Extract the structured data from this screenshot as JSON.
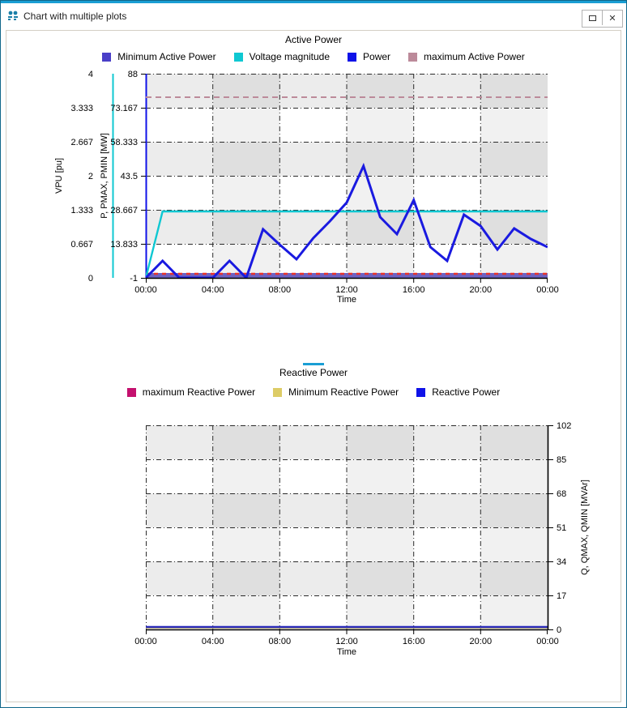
{
  "window": {
    "title": "Chart with multiple plots",
    "icon": "chart-window-icon",
    "restore_label": "❐",
    "close_label": "✕",
    "accent_color": "#1a9ed4"
  },
  "charts": [
    {
      "id": "active-power",
      "title": "Active Power",
      "selected": false,
      "legend": [
        {
          "label": "Minimum Active Power",
          "color": "#4a3fc8"
        },
        {
          "label": "Voltage magnitude",
          "color": "#0fc8d2"
        },
        {
          "label": "Power",
          "color": "#0f12e8"
        },
        {
          "label": "maximum Active Power",
          "color": "#bc8a9a"
        }
      ],
      "axes": {
        "left_outer": {
          "title": "VPU [pu]",
          "ticks": [
            "0",
            "0.667",
            "1.333",
            "2",
            "2.667",
            "3.333",
            "4"
          ],
          "min": 0,
          "max": 4,
          "color": "#0fc8d2"
        },
        "left_inner": {
          "title": "P, PMAX, PMIN [MW]",
          "ticks": [
            "-1",
            "13.833",
            "28.667",
            "43.5",
            "58.333",
            "73.167",
            "88"
          ],
          "min": -1,
          "max": 88,
          "color": "#0f12e8"
        },
        "x": {
          "title": "Time",
          "ticks": [
            "00:00",
            "04:00",
            "08:00",
            "12:00",
            "16:00",
            "20:00",
            "00:00"
          ]
        }
      }
    },
    {
      "id": "reactive-power",
      "title": "Reactive Power",
      "selected": true,
      "legend": [
        {
          "label": "maximum Reactive Power",
          "color": "#c4106e"
        },
        {
          "label": "Minimum Reactive Power",
          "color": "#ddcc66"
        },
        {
          "label": "Reactive Power",
          "color": "#0f12e8"
        }
      ],
      "axes": {
        "right": {
          "title": "Q, QMAX, QMIN [MVAr]",
          "ticks": [
            "0",
            "17",
            "34",
            "51",
            "68",
            "85",
            "102"
          ],
          "min": 0,
          "max": 102
        },
        "x": {
          "title": "Time",
          "ticks": [
            "00:00",
            "04:00",
            "08:00",
            "12:00",
            "16:00",
            "20:00",
            "00:00"
          ]
        }
      }
    }
  ],
  "chart_data": [
    {
      "type": "line",
      "title": "Active Power",
      "xlabel": "Time",
      "ylabel": "P, PMAX, PMIN [MW]",
      "y2label": "VPU [pu]",
      "xtick_labels": [
        "00:00",
        "04:00",
        "08:00",
        "12:00",
        "16:00",
        "20:00",
        "00:00"
      ],
      "xlim": [
        0,
        24
      ],
      "ylim": [
        -1,
        88
      ],
      "y2lim": [
        0,
        4
      ],
      "grid": true,
      "legend_position": "top",
      "x": [
        0,
        1,
        2,
        3,
        4,
        5,
        6,
        7,
        8,
        9,
        10,
        11,
        12,
        13,
        14,
        15,
        16,
        17,
        18,
        19,
        20,
        21,
        22,
        23,
        24
      ],
      "series": [
        {
          "name": "Power",
          "color": "#0f12e8",
          "axis": "left",
          "values": [
            -1,
            6.5,
            -1,
            -1,
            -1,
            6.5,
            -1,
            19.0,
            13.8,
            7.2,
            16.5,
            24.5,
            33.5,
            49.5,
            25.0,
            16.8,
            34.0,
            13.0,
            6.5,
            27.0,
            22.0,
            12.5,
            21.5,
            17.5,
            13.0
          ]
        },
        {
          "name": "Voltage magnitude",
          "color": "#0fc8d2",
          "axis": "right",
          "values": [
            0.0,
            0.97,
            0.97,
            0.97,
            0.97,
            0.97,
            0.97,
            0.97,
            0.97,
            0.97,
            0.97,
            0.97,
            0.97,
            0.97,
            0.97,
            0.97,
            0.97,
            0.97,
            0.97,
            0.97,
            0.97,
            0.97,
            0.97,
            0.97,
            0.97
          ]
        },
        {
          "name": "maximum Active Power",
          "color": "#bc8a9a",
          "axis": "left",
          "style": "dashed",
          "values": [
            80.5,
            80.5,
            80.5,
            80.5,
            80.5,
            80.5,
            80.5,
            80.5,
            80.5,
            80.5,
            80.5,
            80.5,
            80.5,
            80.5,
            80.5,
            80.5,
            80.5,
            80.5,
            80.5,
            80.5,
            80.5,
            80.5,
            80.5,
            80.5,
            80.5
          ]
        },
        {
          "name": "Minimum Active Power",
          "color": "#4a3fc8",
          "axis": "left",
          "values": [
            0,
            0,
            0,
            0,
            0,
            0,
            0,
            0,
            0,
            0,
            0,
            0,
            0,
            0,
            0,
            0,
            0,
            0,
            0,
            0,
            0,
            0,
            0,
            0,
            0
          ]
        }
      ]
    },
    {
      "type": "line",
      "title": "Reactive Power",
      "xlabel": "Time",
      "ylabel": "Q, QMAX, QMIN [MVAr]",
      "xtick_labels": [
        "00:00",
        "04:00",
        "08:00",
        "12:00",
        "16:00",
        "20:00",
        "00:00"
      ],
      "xlim": [
        0,
        24
      ],
      "ylim": [
        0,
        102
      ],
      "grid": true,
      "legend_position": "top",
      "x": [
        0,
        24
      ],
      "series": [
        {
          "name": "maximum Reactive Power",
          "color": "#c4106e",
          "values": [
            0,
            0
          ]
        },
        {
          "name": "Minimum Reactive Power",
          "color": "#ddcc66",
          "values": [
            0,
            0
          ]
        },
        {
          "name": "Reactive Power",
          "color": "#0f12e8",
          "values": [
            0,
            0
          ]
        }
      ]
    }
  ]
}
